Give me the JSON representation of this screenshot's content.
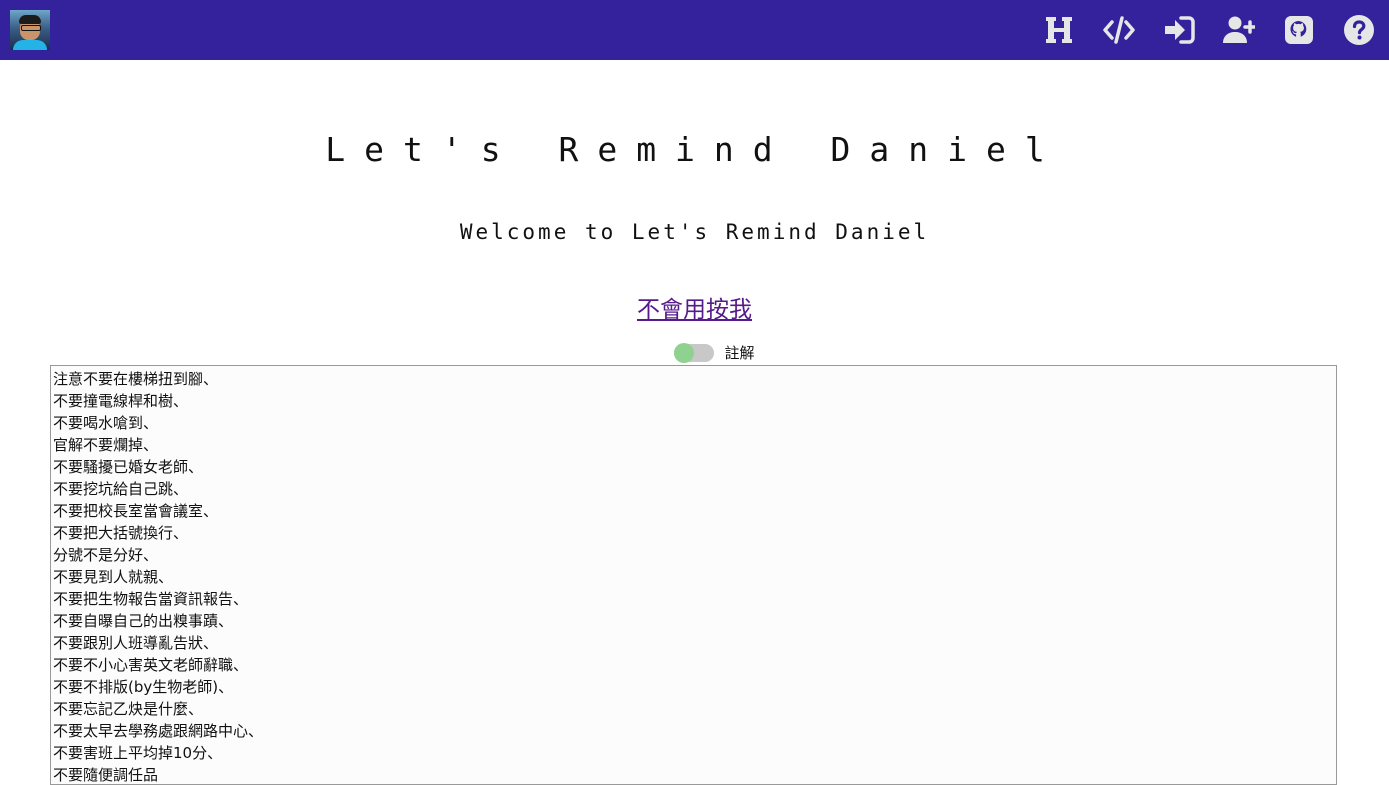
{
  "header": {
    "avatar_alt": "avatar",
    "icons": [
      {
        "name": "h-icon"
      },
      {
        "name": "code-icon"
      },
      {
        "name": "sign-in-icon"
      },
      {
        "name": "user-plus-icon"
      },
      {
        "name": "github-icon"
      },
      {
        "name": "help-icon"
      }
    ],
    "color": "#33229b"
  },
  "main": {
    "title": "Let's Remind Daniel",
    "subtitle": "Welcome to Let's Remind Daniel",
    "help_link": "不會用按我",
    "toggle": {
      "label": "註解",
      "knob_color": "#8fd18f",
      "track_color": "#c8c8c8"
    }
  },
  "textarea": {
    "lines": [
      "注意不要在樓梯扭到腳、",
      "不要撞電線桿和樹、",
      "不要喝水嗆到、",
      "官解不要爛掉、",
      "不要騷擾已婚女老師、",
      "不要挖坑給自己跳、",
      "不要把校長室當會議室、",
      "不要把大括號換行、",
      "分號不是分好、",
      "不要見到人就親、",
      "不要把生物報告當資訊報告、",
      "不要自曝自己的出糗事蹟、",
      "不要跟別人班導亂告狀、",
      "不要不小心害英文老師辭職、",
      "不要不排版(by生物老師)、",
      "不要忘記乙炔是什麼、",
      "不要太早去學務處跟網路中心、",
      "不要害班上平均掉10分、",
      "不要隨便調任品"
    ]
  }
}
